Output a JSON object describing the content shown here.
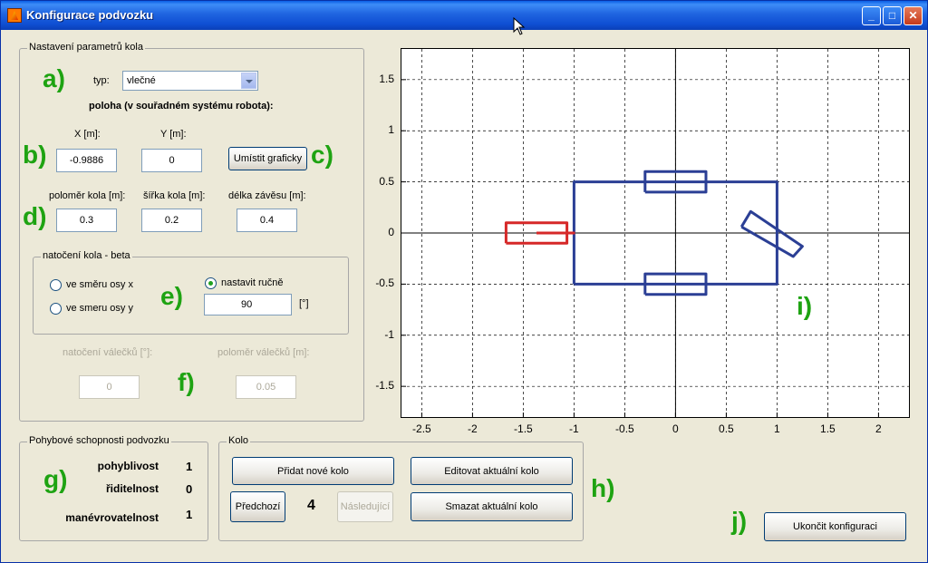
{
  "window": {
    "title": "Konfigurace podvozku"
  },
  "wheel_params": {
    "group_title": "Nastavení parametrů kola",
    "type_label": "typ:",
    "type_value": "vlečné",
    "position_heading": "poloha (v souřadném systému robota):",
    "x_label": "X [m]:",
    "x_value": "-0.9886",
    "y_label": "Y [m]:",
    "y_value": "0",
    "place_button": "Umístit graficky",
    "radius_label": "poloměr kola [m]:",
    "radius_value": "0.3",
    "width_label": "šířka kola [m]:",
    "width_value": "0.2",
    "hinge_label": "délka závěsu [m]:",
    "hinge_value": "0.4",
    "rotation_group": "natočení kola - beta",
    "radio_x": "ve směru osy x",
    "radio_y": "ve smeru osy y",
    "radio_manual": "nastavit ručně",
    "manual_value": "90",
    "deg_unit": "[°]",
    "roller_rot_label": "natočení válečků [°]:",
    "roller_rot_value": "0",
    "roller_radius_label": "poloměr válečků [m]:",
    "roller_radius_value": "0.05"
  },
  "motion": {
    "group_title": "Pohybové schopnosti podvozku",
    "mobility_label": "pohyblivost",
    "mobility_value": "1",
    "steerability_label": "řiditelnost",
    "steerability_value": "0",
    "maneuverability_label": "manévrovatelnost",
    "maneuverability_value": "1"
  },
  "wheel_group": {
    "title": "Kolo",
    "add_button": "Přidat nové kolo",
    "edit_button": "Editovat aktuální kolo",
    "prev_button": "Předchozí",
    "current_index": "4",
    "next_button": "Následující",
    "delete_button": "Smazat aktuální kolo"
  },
  "finish_button": "Ukončit konfiguraci",
  "markers": {
    "a": "a)",
    "b": "b)",
    "c": "c)",
    "d": "d)",
    "e": "e)",
    "f": "f)",
    "g": "g)",
    "h": "h)",
    "i": "i)",
    "j": "j)"
  },
  "chart_data": {
    "type": "line",
    "xlim": [
      -2.7,
      2.3
    ],
    "ylim": [
      -1.8,
      1.8
    ],
    "grid": true,
    "xticks": [
      "-2.5",
      "-2",
      "-1.5",
      "-1",
      "-0.5",
      "0",
      "0.5",
      "1",
      "1.5",
      "2"
    ],
    "yticks": [
      "1.5",
      "1",
      "0.5",
      "0",
      "-0.5",
      "-1",
      "-1.5"
    ],
    "axis_lines": true,
    "colors": {
      "chassis": "#2b3f95",
      "active_wheel": "#d62828"
    },
    "shapes": [
      {
        "name": "chassis",
        "color": "#2b3f95",
        "points": [
          [
            -1,
            -0.5
          ],
          [
            1,
            -0.5
          ],
          [
            1,
            0.5
          ],
          [
            -1,
            0.5
          ],
          [
            -1,
            -0.5
          ]
        ]
      },
      {
        "name": "wheel-top",
        "color": "#2b3f95",
        "points": [
          [
            -0.3,
            0.4
          ],
          [
            0.3,
            0.4
          ],
          [
            0.3,
            0.6
          ],
          [
            -0.3,
            0.6
          ],
          [
            -0.3,
            0.4
          ]
        ]
      },
      {
        "name": "wheel-bottom",
        "color": "#2b3f95",
        "points": [
          [
            -0.3,
            -0.6
          ],
          [
            0.3,
            -0.6
          ],
          [
            0.3,
            -0.4
          ],
          [
            -0.3,
            -0.4
          ],
          [
            -0.3,
            -0.6
          ]
        ]
      },
      {
        "name": "wheel-right",
        "color": "#2b3f95",
        "points": [
          [
            0.65,
            0.06
          ],
          [
            0.74,
            0.21
          ],
          [
            1.25,
            -0.13
          ],
          [
            1.16,
            -0.23
          ],
          [
            0.65,
            0.06
          ]
        ]
      },
      {
        "name": "active-wheel",
        "color": "#d62828",
        "points": [
          [
            -1.67,
            -0.1
          ],
          [
            -1.07,
            -0.1
          ],
          [
            -1.07,
            0.1
          ],
          [
            -1.67,
            0.1
          ],
          [
            -1.67,
            -0.1
          ]
        ]
      },
      {
        "name": "hinge",
        "color": "#d62828",
        "points": [
          [
            -1.37,
            0
          ],
          [
            -0.99,
            0
          ]
        ]
      }
    ]
  }
}
